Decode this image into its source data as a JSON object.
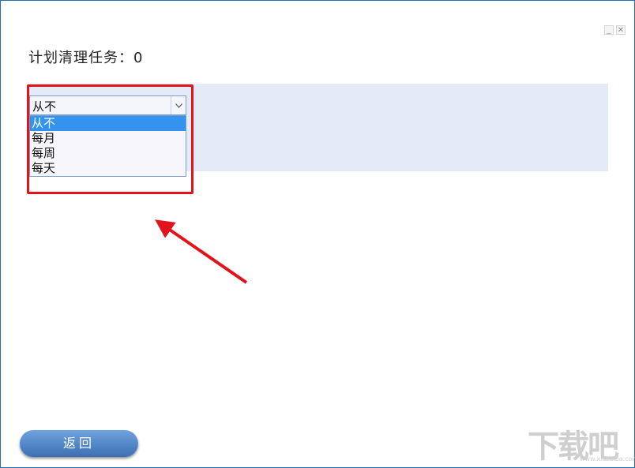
{
  "window": {
    "minimize_label": "_",
    "close_label": "✕"
  },
  "header": {
    "title": "计划清理任务：0"
  },
  "schedule": {
    "selected_value": "从不",
    "options": [
      "从不",
      "每月",
      "每周",
      "每天"
    ],
    "selected_index": 0
  },
  "footer": {
    "back_label": "返回"
  },
  "watermark": {
    "text": "下载吧",
    "url": "www.xiazaiba.com"
  },
  "colors": {
    "accent": "#3393ee",
    "highlight": "#e0141a",
    "band": "#e4ebf6",
    "button": "#4a7fc3"
  }
}
